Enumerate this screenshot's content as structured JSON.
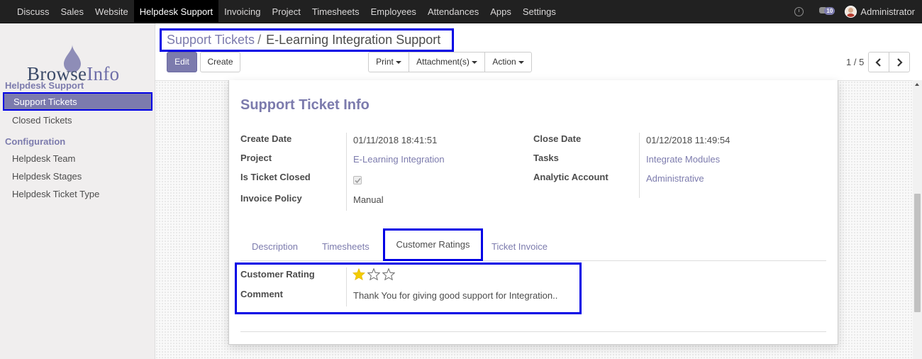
{
  "topbar": {
    "menu": [
      "Discuss",
      "Sales",
      "Website",
      "Helpdesk Support",
      "Invoicing",
      "Project",
      "Timesheets",
      "Employees",
      "Attendances",
      "Apps",
      "Settings"
    ],
    "active_menu": "Helpdesk Support",
    "chat_badge": "10",
    "user": "Administrator"
  },
  "sidebar": {
    "logo_text_a": "Browse",
    "logo_text_b": "Info",
    "section1": "Helpdesk Support",
    "items1": [
      "Support Tickets",
      "Closed Tickets"
    ],
    "section2": "Configuration",
    "items2": [
      "Helpdesk Team",
      "Helpdesk Stages",
      "Helpdesk Ticket Type"
    ]
  },
  "breadcrumb": {
    "parent": "Support Tickets",
    "separator": "/",
    "current": "E-Learning Integration Support"
  },
  "buttons": {
    "edit": "Edit",
    "create": "Create",
    "print": "Print",
    "attachments": "Attachment(s)",
    "action": "Action"
  },
  "pager": "1 / 5",
  "sheet": {
    "title": "Support Ticket Info",
    "left_fields": [
      {
        "label": "Create Date",
        "value": "01/11/2018 18:41:51"
      },
      {
        "label": "Project",
        "value": "E-Learning Integration"
      },
      {
        "label": "Is Ticket Closed",
        "value": "checked"
      },
      {
        "label": "Invoice Policy",
        "value": "Manual"
      }
    ],
    "right_fields": [
      {
        "label": "Close Date",
        "value": "01/12/2018 11:49:54"
      },
      {
        "label": "Tasks",
        "value": "Integrate Modules"
      },
      {
        "label": "Analytic Account",
        "value": "Administrative"
      }
    ],
    "tabs": [
      "Description",
      "Timesheets",
      "Customer Ratings",
      "Ticket Invoice"
    ],
    "active_tab": "Customer Ratings",
    "rating": {
      "label": "Customer Rating",
      "value": 1,
      "max": 3,
      "comment_label": "Comment",
      "comment": "Thank You for giving good support for Integration.."
    }
  },
  "colors": {
    "accent": "#7c7bad",
    "highlight_box": "#0000e5",
    "topbar": "#212121",
    "star_filled": "#f3cc00"
  }
}
